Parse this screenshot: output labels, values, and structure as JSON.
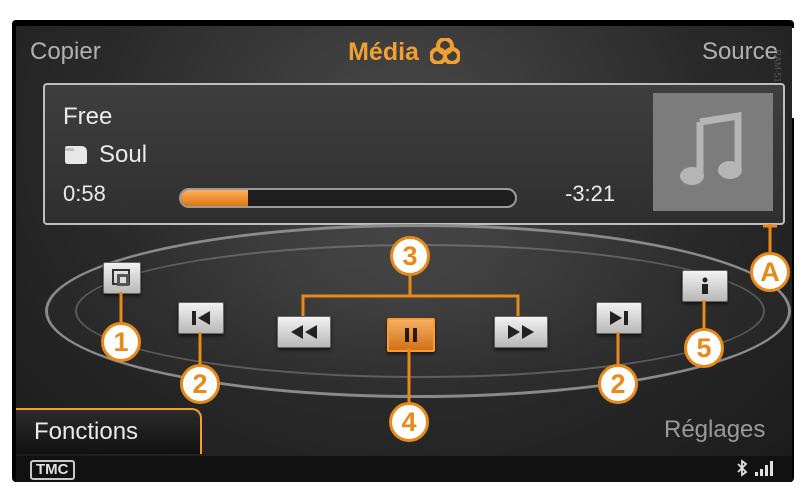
{
  "header": {
    "left": "Copier",
    "center": "Média",
    "right": "Source",
    "side_code": "RAM-5122"
  },
  "now_playing": {
    "title": "Free",
    "genre": "Soul",
    "elapsed": "0:58",
    "remaining": "-3:21",
    "progress": 0.2
  },
  "controls": [
    {
      "name": "mode-icon"
    },
    {
      "name": "previous-track-icon"
    },
    {
      "name": "rewind-icon"
    },
    {
      "name": "pause-icon"
    },
    {
      "name": "fast-forward-icon"
    },
    {
      "name": "next-track-icon"
    },
    {
      "name": "info-icon"
    }
  ],
  "callouts": {
    "c1": "1",
    "c2a": "2",
    "c2b": "2",
    "c3": "3",
    "c4": "4",
    "c5": "5",
    "cA": "A"
  },
  "footer": {
    "left": "Fonctions",
    "right": "Réglages",
    "tmc": "TMC"
  },
  "colors": {
    "accent": "#f0a030",
    "callout": "#e88a1a",
    "background": "#2a2a2a"
  }
}
